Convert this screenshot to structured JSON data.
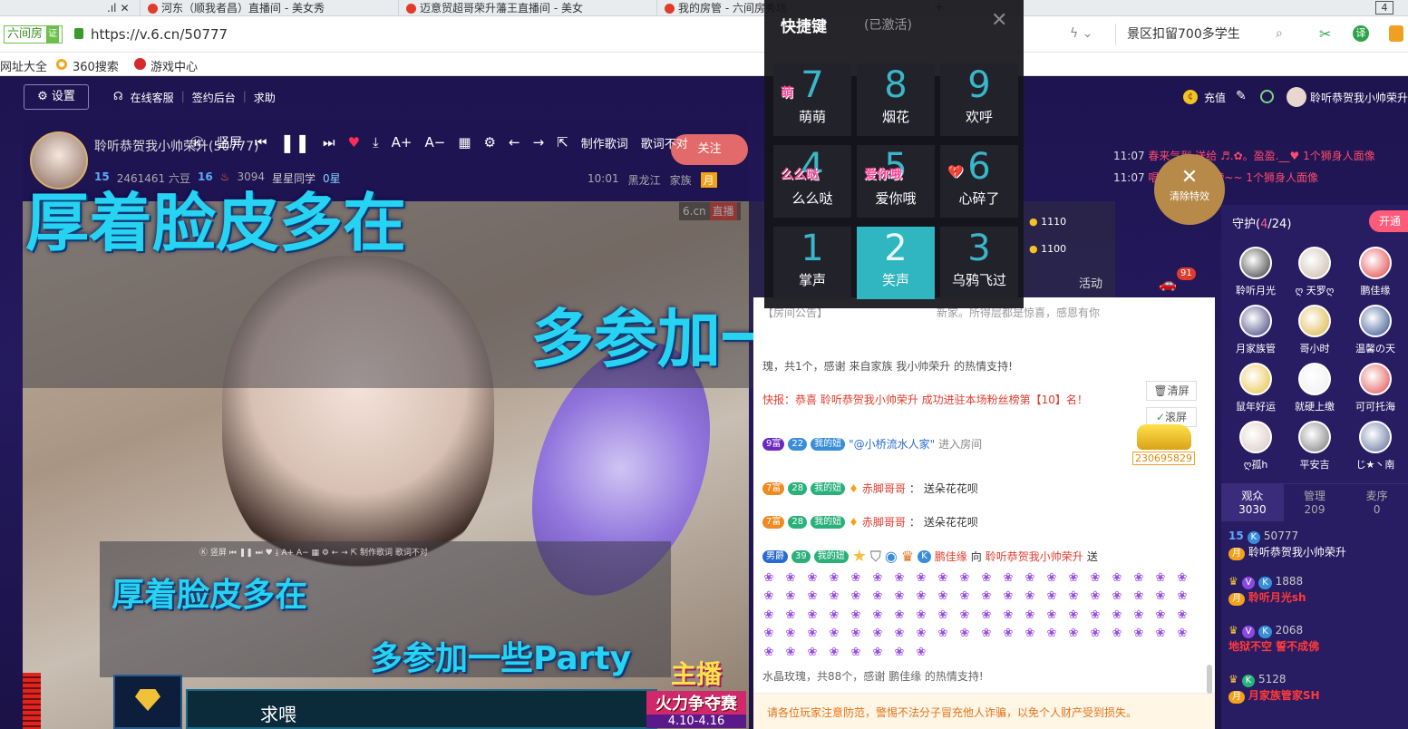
{
  "browser": {
    "tabs": [
      {
        "label": "河东（顺我者昌）直播间 - 美女秀"
      },
      {
        "label": "迈意贸超哥荣升藩王直播间 - 美女"
      },
      {
        "label": "我的房管 - 六间房秀场"
      }
    ],
    "tab_count": "4",
    "site_badge": "六间房",
    "site_badge_cert": "证",
    "url": "https://v.6.cn/50777",
    "search_value": "景区扣留700多学生",
    "bookmarks": [
      "网址大全",
      "360搜索",
      "游戏中心"
    ]
  },
  "site_header": {
    "settings": "设置",
    "service": "在线客服",
    "sign": "签约后台",
    "help": "求助",
    "recharge": "充值",
    "username": "聆听恭贺我小帅荣升"
  },
  "anchor": {
    "name": "聆听恭贺我小帅荣升(50777)",
    "level": "15",
    "beans": "2461461 六豆",
    "fans_level": "16",
    "heat": "3094",
    "star_tag": "星星同学",
    "star_count": "0星",
    "time": "10:01",
    "location": "黑龙江",
    "family": "家族",
    "family_badge": "月",
    "follow": "关注"
  },
  "player_controls": {
    "bg_label": "竖屏",
    "make_lyrics": "制作歌词",
    "lyrics_wrong": "歌词不对",
    "logo": "6.cn",
    "live": "直播"
  },
  "lyrics": {
    "line1": "厚着脸皮多在",
    "line2": "多参加一些Party",
    "small_line1": "厚着脸皮多在",
    "small_line2": "多参加一些Party",
    "bottom_text": "求喂"
  },
  "promo": {
    "title": "主播",
    "subtitle": "火力争夺赛",
    "date": "4.10-4.16"
  },
  "shortcut_panel": {
    "title": "快捷键",
    "status": "(已激活)",
    "keys": [
      {
        "num": "7",
        "label": "萌萌",
        "icon": "萌"
      },
      {
        "num": "8",
        "label": "烟花",
        "icon": ""
      },
      {
        "num": "9",
        "label": "欢呼",
        "icon": ""
      },
      {
        "num": "4",
        "label": "么么哒",
        "icon": "么么哒"
      },
      {
        "num": "5",
        "label": "爱你哦",
        "icon": "爱你哦"
      },
      {
        "num": "6",
        "label": "心碎了",
        "icon": "💔"
      },
      {
        "num": "1",
        "label": "掌声",
        "icon": ""
      },
      {
        "num": "2",
        "label": "笑声",
        "icon": ""
      },
      {
        "num": "3",
        "label": "乌鸦飞过",
        "icon": ""
      }
    ]
  },
  "clear_effects": "清除特效",
  "top_messages": [
    {
      "time": "11:07",
      "text": "春来气到 送给 ♬.✿。盈盈.__♥ 1个狮身人面像"
    },
    {
      "time": "11:07",
      "text": "唱歌蟠求百元榜~~ 1个狮身人面像"
    }
  ],
  "rank_values": [
    "1110",
    "1100"
  ],
  "chat_tabs": {
    "activity": "活动",
    "car_badge": "91"
  },
  "chat": {
    "notice_partial": "【房间公告】",
    "notice_text": "新家。所得层都是惊喜，感恩有你",
    "gift_line": "瑰，共1个，感谢 来自家族 我小帅荣升 的热情支持!",
    "flash": "快报：恭喜 聆听恭贺我小帅荣升 成功进驻本场粉丝榜第【10】名！",
    "clear_btn": "清屏",
    "scroll_btn": "滚屏",
    "car_id": "230695829",
    "entry": {
      "rich": "9富",
      "level": "22",
      "tag": "我的妞",
      "name": "\"@小桥流水人家\"",
      "action": "进入房间"
    },
    "msg1": {
      "rich": "7富",
      "level": "28",
      "tag": "我的妞",
      "name": "赤脚哥哥",
      "text": "送朵花花呗"
    },
    "msg2": {
      "rich": "7富",
      "level": "28",
      "tag": "我的妞",
      "name": "赤脚哥哥",
      "text": "送朵花花呗"
    },
    "gift_msg": {
      "rich": "男爵",
      "level": "39",
      "tag": "我的妞",
      "name": "鹏佳缘",
      "to": "向",
      "target": "聆听恭贺我小帅荣升",
      "action": "送"
    },
    "gift_summary": "水晶玫瑰，共88个，感谢 鹏佳缘 的热情支持!",
    "warning": "请各位玩家注意防范，警惕不法分子冒充他人诈骗，以免个人财产受到损失。"
  },
  "guards": {
    "title": "守护",
    "count": "4",
    "total": "24",
    "open_btn": "开通",
    "members": [
      "聆听月光",
      "ღ 天罗ღ",
      "鹏佳缘",
      "月家族管",
      "哥小时",
      "温馨の天",
      "鼠年好运",
      "就硬上缴",
      "可可托海",
      "ღ孤h",
      "平安吉",
      "じ★丶南"
    ]
  },
  "audience_tabs": [
    {
      "label": "观众",
      "count": "3030"
    },
    {
      "label": "管理",
      "count": "209"
    },
    {
      "label": "麦序",
      "count": "0"
    }
  ],
  "viewers": [
    {
      "level": "15",
      "score": "50777",
      "name": "聆听恭贺我小帅荣升"
    },
    {
      "level": "",
      "score": "1888",
      "name": "聆听月光sh"
    },
    {
      "level": "",
      "score": "2068",
      "name": "地狱不空 誓不成佛"
    },
    {
      "level": "",
      "score": "5128",
      "name": "月家族管家SH"
    }
  ],
  "colors": {
    "accent": "#27d3f2",
    "brand_red": "#e23b2e",
    "site_bg": "#1e1450"
  }
}
